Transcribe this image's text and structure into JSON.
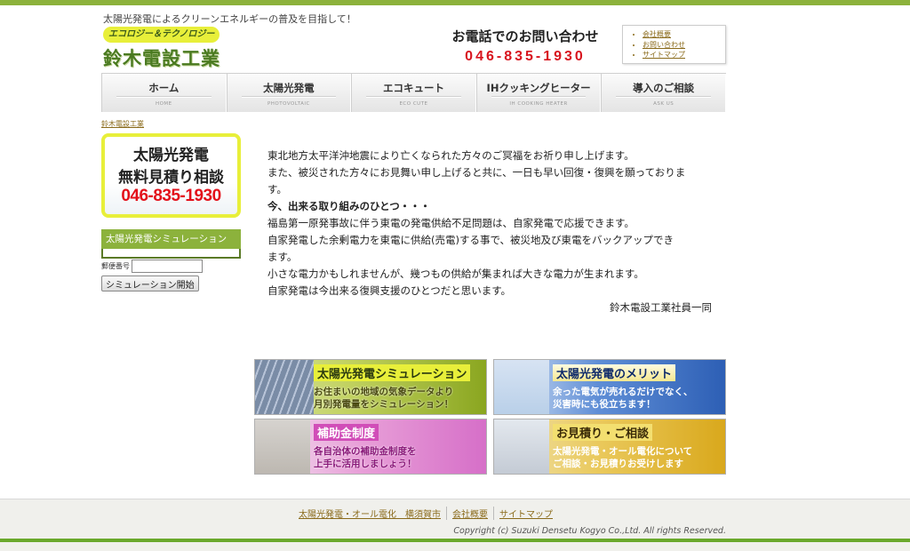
{
  "header": {
    "tagline": "太陽光発電によるクリーンエネルギーの普及を目指して！",
    "logo_sub": "エコロジー＆テクノロジー",
    "logo_main": "鈴木電設工業",
    "contact_label": "お電話でのお問い合わせ",
    "contact_phone": "046-835-1930",
    "links": [
      "会社概要",
      "お問い合わせ",
      "サイトマップ"
    ]
  },
  "nav": [
    {
      "label": "ホーム",
      "sub": "HOME"
    },
    {
      "label": "太陽光発電",
      "sub": "PHOTOVOLTAIC"
    },
    {
      "label": "エコキュート",
      "sub": "ECO CUTE"
    },
    {
      "label": "IHクッキングヒーター",
      "sub": "IH COOKING HEATER"
    },
    {
      "label": "導入のご相談",
      "sub": "ASK US"
    }
  ],
  "breadcrumb": "鈴木電設工業",
  "sidebar": {
    "banner_line1": "太陽光発電",
    "banner_line2": "無料見積り相談",
    "banner_phone": "046-835-1930",
    "sim_title": "太陽光発電シミュレーション",
    "zip_label": "郵便番号",
    "zip_value": "",
    "sim_button": "シミュレーション開始"
  },
  "article": {
    "para1_line1": "東北地方太平洋沖地震により亡くなられた方々のご冥福をお祈り申し上げます。",
    "para1_line2": "また、被災された方々にお見舞い申し上げると共に、一日も早い回復・復興を願っておりま",
    "para1_line3": "す。",
    "heading": "今、出来る取り組みのひとつ・・・",
    "para2_line1": "福島第一原発事故に伴う東電の発電供給不足問題は、自家発電で応援できます。",
    "para2_line2": "自家発電した余剰電力を東電に供給(売電)する事で、被災地及び東電をバックアップでき",
    "para2_line3": "ます。",
    "para2_line4": "小さな電力かもしれませんが、幾つもの供給が集まれば大きな電力が生まれます。",
    "para2_line5": "自家発電は今出来る復興支援のひとつだと思います。",
    "signature": "鈴木電設工業社員一同"
  },
  "tiles": [
    {
      "title": "太陽光発電シミュレーション",
      "desc1": "お住まいの地域の気象データより",
      "desc2": "月別発電量をシミュレーション！"
    },
    {
      "title": "太陽光発電のメリット",
      "desc1": "余った電気が売れるだけでなく、",
      "desc2": "災害時にも役立ちます！"
    },
    {
      "title": "補助金制度",
      "desc1": "各自治体の補助金制度を",
      "desc2": "上手に活用しましょう！"
    },
    {
      "title": "お見積り・ご相談",
      "desc1": "太陽光発電・オール電化について",
      "desc2": "ご相談・お見積りお受けします"
    }
  ],
  "footer": {
    "links": [
      "太陽光発電・オール電化　横須賀市",
      "会社概要",
      "サイトマップ"
    ],
    "copyright": "Copyright (c) Suzuki Densetu Kogyo Co.,Ltd. All rights Reserved."
  }
}
